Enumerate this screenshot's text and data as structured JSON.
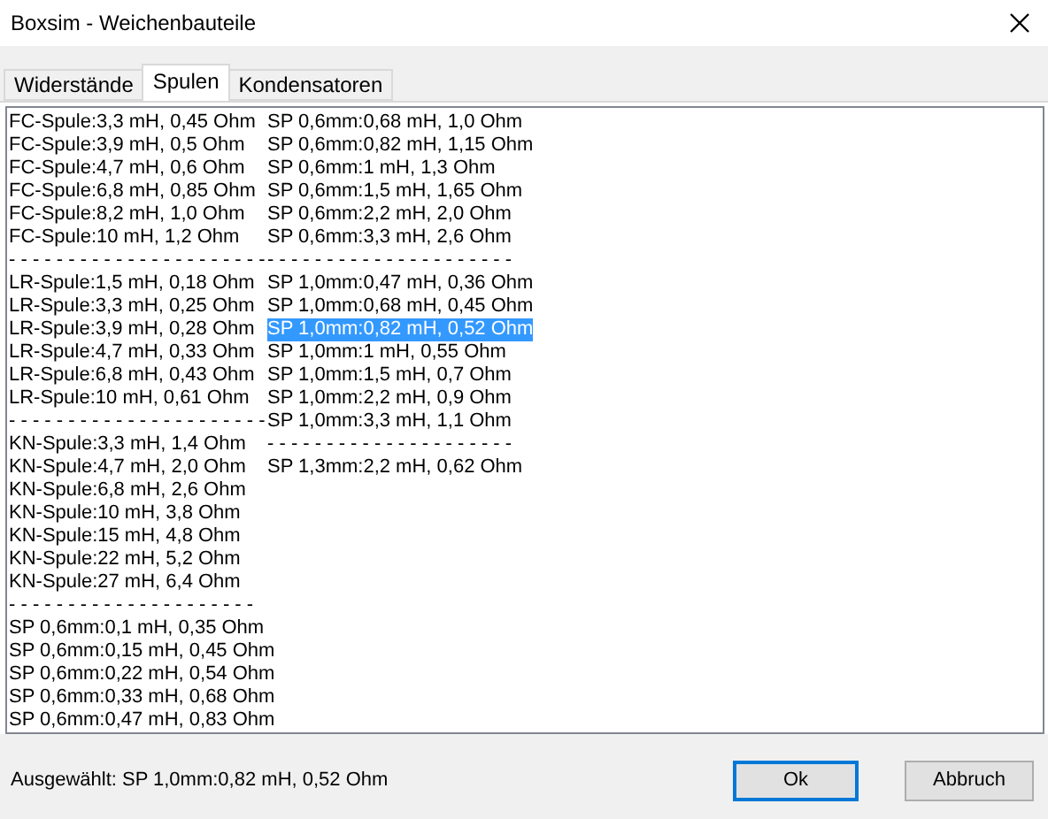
{
  "window": {
    "title": "Boxsim - Weichenbauteile"
  },
  "tabs": [
    {
      "label": "Widerstände",
      "selected": false
    },
    {
      "label": "Spulen",
      "selected": true
    },
    {
      "label": "Kondensatoren",
      "selected": false
    }
  ],
  "listbox": {
    "columns": [
      [
        {
          "text": "FC-Spule:3,3 mH, 0,45 Ohm",
          "selected": false
        },
        {
          "text": "FC-Spule:3,9 mH, 0,5 Ohm",
          "selected": false
        },
        {
          "text": "FC-Spule:4,7 mH, 0,6 Ohm",
          "selected": false
        },
        {
          "text": "FC-Spule:6,8 mH, 0,85 Ohm",
          "selected": false
        },
        {
          "text": "FC-Spule:8,2 mH, 1,0 Ohm",
          "selected": false
        },
        {
          "text": "FC-Spule:10 mH, 1,2 Ohm",
          "selected": false
        },
        {
          "text": "- - - - - - - - - - - - - - - - - - - - - -",
          "selected": false
        },
        {
          "text": "LR-Spule:1,5 mH, 0,18 Ohm",
          "selected": false
        },
        {
          "text": "LR-Spule:3,3 mH, 0,25 Ohm",
          "selected": false
        },
        {
          "text": "LR-Spule:3,9 mH, 0,28 Ohm",
          "selected": false
        },
        {
          "text": "LR-Spule:4,7 mH, 0,33 Ohm",
          "selected": false
        },
        {
          "text": "LR-Spule:6,8 mH, 0,43 Ohm",
          "selected": false
        },
        {
          "text": "LR-Spule:10 mH, 0,61 Ohm",
          "selected": false
        },
        {
          "text": "- - - - - - - - - - - - - - - - - - - - - -",
          "selected": false
        },
        {
          "text": "KN-Spule:3,3 mH, 1,4 Ohm",
          "selected": false
        },
        {
          "text": "KN-Spule:4,7 mH, 2,0 Ohm",
          "selected": false
        },
        {
          "text": "KN-Spule:6,8 mH, 2,6 Ohm",
          "selected": false
        },
        {
          "text": "KN-Spule:10 mH, 3,8 Ohm",
          "selected": false
        },
        {
          "text": "KN-Spule:15 mH, 4,8 Ohm",
          "selected": false
        },
        {
          "text": "KN-Spule:22 mH, 5,2 Ohm",
          "selected": false
        },
        {
          "text": "KN-Spule:27 mH, 6,4 Ohm",
          "selected": false
        },
        {
          "text": "- - - - - - - - - - - - - - - - - - - - -",
          "selected": false
        },
        {
          "text": "SP 0,6mm:0,1 mH, 0,35 Ohm",
          "selected": false
        },
        {
          "text": "SP 0,6mm:0,15 mH, 0,45 Ohm",
          "selected": false
        },
        {
          "text": "SP 0,6mm:0,22 mH, 0,54 Ohm",
          "selected": false
        },
        {
          "text": "SP 0,6mm:0,33 mH, 0,68 Ohm",
          "selected": false
        },
        {
          "text": "SP 0,6mm:0,47 mH, 0,83 Ohm",
          "selected": false
        }
      ],
      [
        {
          "text": "SP 0,6mm:0,68 mH, 1,0 Ohm",
          "selected": false
        },
        {
          "text": "SP 0,6mm:0,82 mH, 1,15 Ohm",
          "selected": false
        },
        {
          "text": "SP 0,6mm:1 mH, 1,3 Ohm",
          "selected": false
        },
        {
          "text": "SP 0,6mm:1,5 mH, 1,65 Ohm",
          "selected": false
        },
        {
          "text": "SP 0,6mm:2,2 mH, 2,0 Ohm",
          "selected": false
        },
        {
          "text": "SP 0,6mm:3,3 mH, 2,6 Ohm",
          "selected": false
        },
        {
          "text": "- - - - - - - - - - - - - - - - - - - - -",
          "selected": false
        },
        {
          "text": "SP 1,0mm:0,47 mH, 0,36 Ohm",
          "selected": false
        },
        {
          "text": "SP 1,0mm:0,68 mH, 0,45 Ohm",
          "selected": false
        },
        {
          "text": "SP 1,0mm:0,82 mH, 0,52 Ohm",
          "selected": true
        },
        {
          "text": "SP 1,0mm:1 mH, 0,55 Ohm",
          "selected": false
        },
        {
          "text": "SP 1,0mm:1,5 mH, 0,7 Ohm",
          "selected": false
        },
        {
          "text": "SP 1,0mm:2,2 mH, 0,9 Ohm",
          "selected": false
        },
        {
          "text": "SP 1,0mm:3,3 mH, 1,1 Ohm",
          "selected": false
        },
        {
          "text": "- - - - - - - - - - - - - - - - - - - - -",
          "selected": false
        },
        {
          "text": "SP 1,3mm:2,2 mH, 0,62 Ohm",
          "selected": false
        }
      ]
    ]
  },
  "status": "Ausgewählt: SP 1,0mm:0,82 mH, 0,52 Ohm",
  "buttons": [
    {
      "label": "Ok",
      "focused": true
    },
    {
      "label": "Abbruch",
      "focused": false
    }
  ]
}
